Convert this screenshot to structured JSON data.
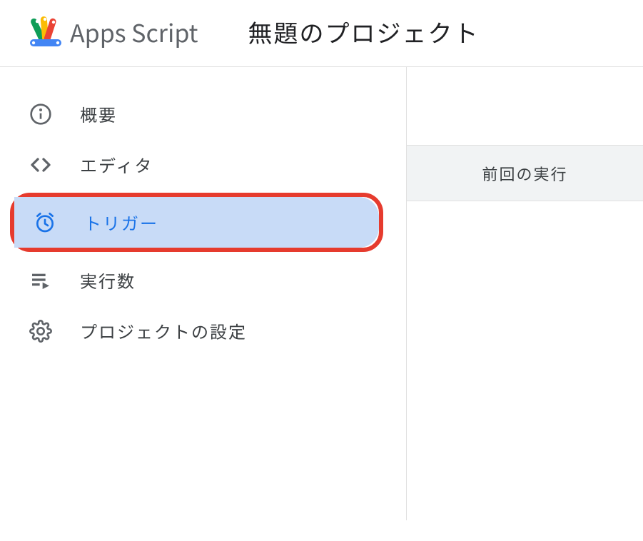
{
  "header": {
    "app_name": "Apps Script",
    "project_title": "無題のプロジェクト"
  },
  "sidebar": {
    "items": [
      {
        "label": "概要",
        "selected": false
      },
      {
        "label": "エディタ",
        "selected": false
      },
      {
        "label": "トリガー",
        "selected": true
      },
      {
        "label": "実行数",
        "selected": false
      },
      {
        "label": "プロジェクトの設定",
        "selected": false
      }
    ]
  },
  "main": {
    "column_header": "前回の実行"
  }
}
